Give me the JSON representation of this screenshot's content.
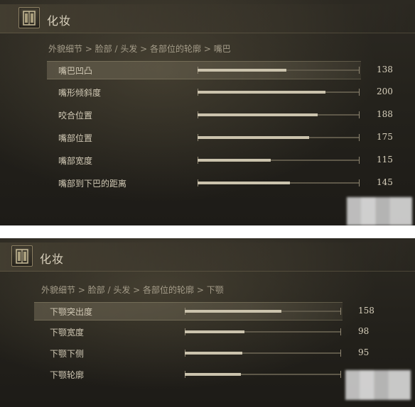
{
  "panels": [
    {
      "title": "化妆",
      "breadcrumb": "外貌细节 > 脸部 / 头发 > 各部位的轮廓 > 嘴巴",
      "rows": [
        {
          "label": "嘴巴凹凸",
          "value": "138",
          "level": 0.55,
          "selected": true
        },
        {
          "label": "嘴形倾斜度",
          "value": "200",
          "level": 0.79
        },
        {
          "label": "咬合位置",
          "value": "188",
          "level": 0.74
        },
        {
          "label": "嘴部位置",
          "value": "175",
          "level": 0.69
        },
        {
          "label": "嘴部宽度",
          "value": "115",
          "level": 0.45
        },
        {
          "label": "嘴部到下巴的距离",
          "value": "145",
          "level": 0.57
        }
      ]
    },
    {
      "title": "化妆",
      "breadcrumb": "外貌细节 > 脸部 / 头发 > 各部位的轮廓 > 下颚",
      "rows": [
        {
          "label": "下颚突出度",
          "value": "158",
          "level": 0.62,
          "selected": true
        },
        {
          "label": "下颚宽度",
          "value": "98",
          "level": 0.38
        },
        {
          "label": "下颚下侧",
          "value": "95",
          "level": 0.37
        },
        {
          "label": "下颚轮廓",
          "value": "",
          "level": 0.36
        }
      ]
    }
  ],
  "icons": {
    "menu": "wardrobe-icon"
  }
}
